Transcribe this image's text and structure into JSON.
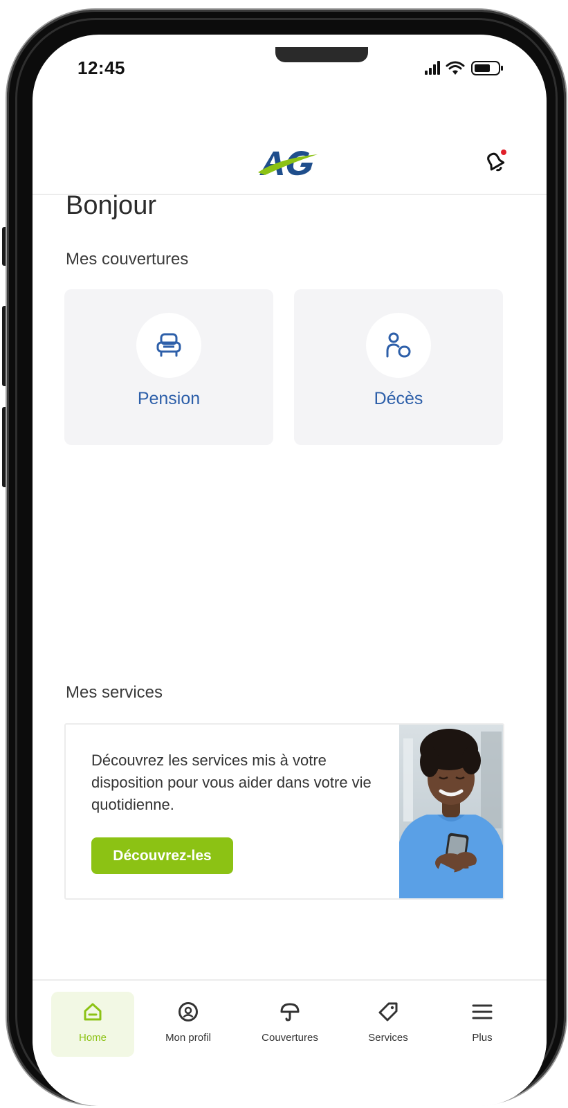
{
  "status_bar": {
    "time": "12:45"
  },
  "header": {
    "logo_text": "AG",
    "notification_icon": "bell-icon"
  },
  "greeting": "Bonjour",
  "coverages": {
    "title": "Mes couvertures",
    "items": [
      {
        "label": "Pension",
        "icon": "armchair-icon"
      },
      {
        "label": "Décès",
        "icon": "people-icon"
      }
    ]
  },
  "services": {
    "title": "Mes services",
    "description": "Découvrez les services mis à votre disposition pour vous aider dans votre vie quotidienne.",
    "button_label": "Découvrez-les"
  },
  "tabbar": {
    "items": [
      {
        "label": "Home",
        "icon": "home-icon",
        "active": true
      },
      {
        "label": "Mon profil",
        "icon": "profile-icon",
        "active": false
      },
      {
        "label": "Couvertures",
        "icon": "umbrella-icon",
        "active": false
      },
      {
        "label": "Services",
        "icon": "tag-icon",
        "active": false
      },
      {
        "label": "Plus",
        "icon": "menu-icon",
        "active": false
      }
    ]
  },
  "colors": {
    "accent_green": "#8cc214",
    "accent_blue": "#2d5fa9",
    "card_bg": "#f4f4f6",
    "notification_dot": "#e0202a"
  }
}
